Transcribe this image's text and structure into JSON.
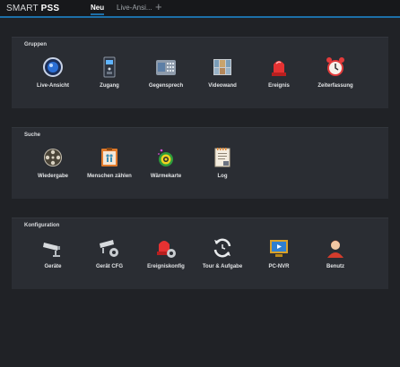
{
  "app": {
    "logo_light": "SMART",
    "logo_bold": "PSS"
  },
  "tabs": [
    {
      "label": "Neu"
    },
    {
      "label": "Live-Ansi..."
    }
  ],
  "add_tab": "+",
  "sections": [
    {
      "title": "Gruppen",
      "items": [
        {
          "label": "Live-Ansicht",
          "icon": "camera-lens-icon"
        },
        {
          "label": "Zugang",
          "icon": "door-access-icon"
        },
        {
          "label": "Gegensprech",
          "icon": "intercom-icon"
        },
        {
          "label": "Videowand",
          "icon": "video-wall-icon"
        },
        {
          "label": "Ereignis",
          "icon": "alarm-light-icon"
        },
        {
          "label": "Zeiterfassung",
          "icon": "alarm-clock-icon"
        }
      ]
    },
    {
      "title": "Suche",
      "items": [
        {
          "label": "Wiedergabe",
          "icon": "film-reel-icon"
        },
        {
          "label": "Menschen zählen",
          "icon": "people-count-icon"
        },
        {
          "label": "Wärmekarte",
          "icon": "heatmap-icon"
        },
        {
          "label": "Log",
          "icon": "log-document-icon"
        }
      ]
    },
    {
      "title": "Konfiguration",
      "items": [
        {
          "label": "Geräte",
          "icon": "cctv-camera-icon"
        },
        {
          "label": "Gerät CFG",
          "icon": "camera-config-icon"
        },
        {
          "label": "Ereigniskonfig",
          "icon": "event-config-icon"
        },
        {
          "label": "Tour & Aufgabe",
          "icon": "refresh-cycle-icon"
        },
        {
          "label": "PC-NVR",
          "icon": "pc-nvr-icon"
        },
        {
          "label": "Benutz",
          "icon": "user-icon"
        }
      ]
    }
  ]
}
